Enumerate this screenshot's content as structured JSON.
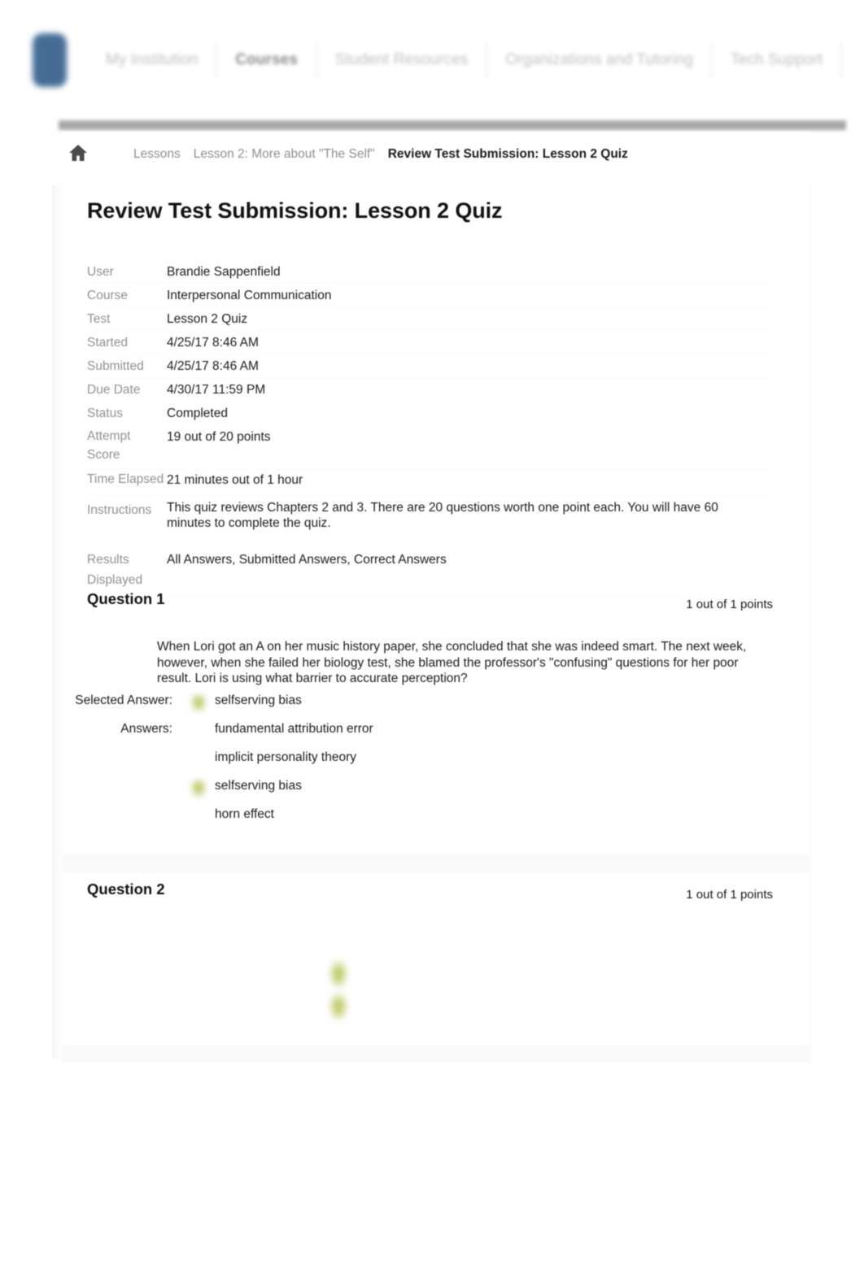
{
  "nav": {
    "logo_icon": "institution-logo",
    "tabs": [
      {
        "label": "My Institution",
        "active": false
      },
      {
        "label": "Courses",
        "active": true
      },
      {
        "label": "Student Resources",
        "active": false
      },
      {
        "label": "Organizations and Tutoring",
        "active": false
      },
      {
        "label": "Tech Support",
        "active": false
      }
    ]
  },
  "breadcrumb": {
    "home_icon": "home-icon",
    "items": [
      {
        "label": "Lessons",
        "current": false
      },
      {
        "label": "Lesson 2: More about \"The Self\"",
        "current": false
      },
      {
        "label": "Review Test Submission: Lesson 2 Quiz",
        "current": true
      }
    ]
  },
  "page": {
    "title": "Review Test Submission: Lesson 2 Quiz"
  },
  "meta": {
    "rows": [
      {
        "label": "User",
        "value": "Brandie Sappenfield"
      },
      {
        "label": "Course",
        "value": "Interpersonal Communication"
      },
      {
        "label": "Test",
        "value": "Lesson 2 Quiz"
      },
      {
        "label": "Started",
        "value": "4/25/17 8:46 AM"
      },
      {
        "label": "Submitted",
        "value": "4/25/17 8:46 AM"
      },
      {
        "label": "Due Date",
        "value": "4/30/17 11:59 PM"
      },
      {
        "label": "Status",
        "value": "Completed"
      },
      {
        "label": "Attempt Score",
        "value": "19 out of 20 points"
      },
      {
        "label": "Time Elapsed",
        "value": "21 minutes out of 1 hour"
      },
      {
        "label": "Instructions",
        "value": "This quiz reviews Chapters 2 and 3. There are 20 questions worth one point each. You will have 60 minutes to complete the quiz."
      },
      {
        "label": "Results Displayed",
        "value": "All Answers, Submitted Answers, Correct Answers"
      }
    ]
  },
  "questions": [
    {
      "title": "Question 1",
      "points": "1 out of 1 points",
      "text": "When Lori got an A on her music history paper, she concluded that she was indeed smart. The next week, however, when she failed her biology test, she blamed the professor's \"confusing\" questions for her poor result. Lori is using what barrier to accurate perception?",
      "selected_answer_label": "Selected Answer:",
      "selected_answer": "selfserving bias",
      "answers_label": "Answers:",
      "answers": [
        {
          "text": "fundamental attribution error",
          "correct": false
        },
        {
          "text": "implicit personality theory",
          "correct": false
        },
        {
          "text": "selfserving bias",
          "correct": true
        },
        {
          "text": "horn effect",
          "correct": false
        }
      ]
    },
    {
      "title": "Question 2",
      "points": "1 out of 1 points",
      "text": "",
      "selected_answer_label": "",
      "selected_answer": "",
      "answers_label": "",
      "answers": []
    }
  ],
  "colors": {
    "brand_logo": "#1e4d80",
    "correct_mark": "#b9c45a",
    "nav_inactive": "#b0b3b6",
    "gray_bar": "#9a9a9a"
  }
}
